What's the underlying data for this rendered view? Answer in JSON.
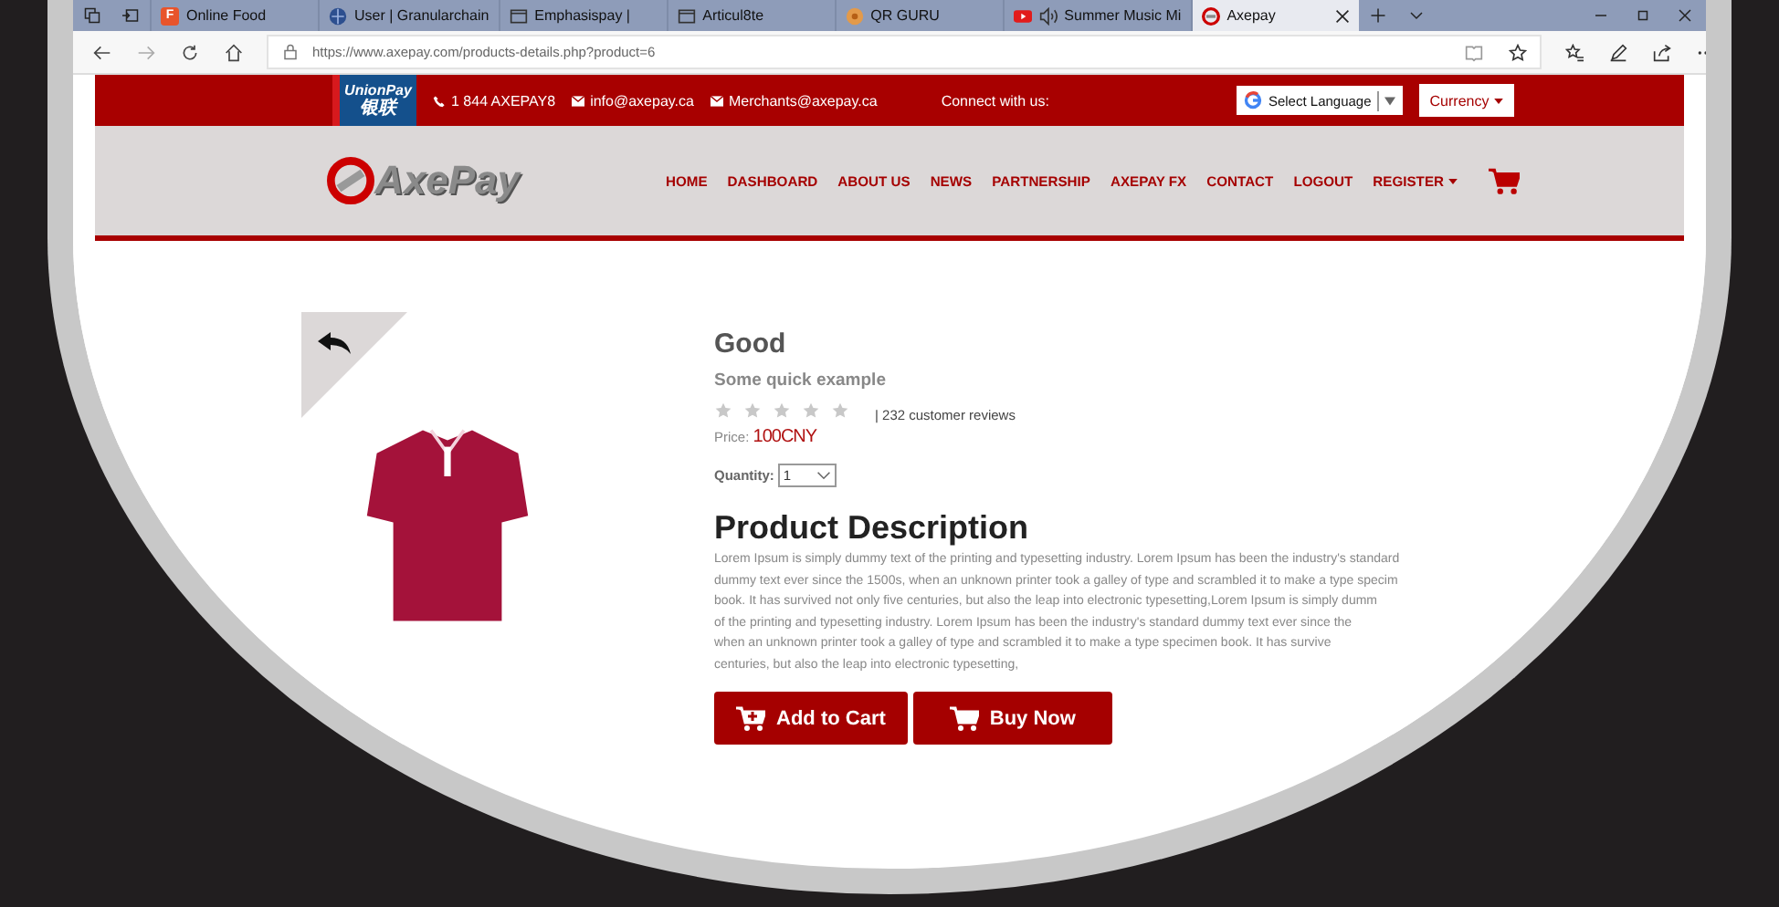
{
  "browser": {
    "tabs": [
      {
        "label": "Online Food",
        "kind": "food",
        "badge": "F",
        "selected": false
      },
      {
        "label": "User | Granularchain",
        "kind": "user",
        "selected": false
      },
      {
        "label": "Emphasispay |",
        "kind": "page",
        "selected": false
      },
      {
        "label": "Articul8te",
        "kind": "page",
        "selected": false
      },
      {
        "label": "QR GURU",
        "kind": "qr",
        "selected": false
      },
      {
        "label": "Summer Music Mi",
        "kind": "video",
        "audio": true,
        "selected": false
      },
      {
        "label": "Axepay",
        "kind": "axepay",
        "selected": true
      }
    ],
    "address": "https://www.axepay.com/products-details.php?product=6"
  },
  "topbar": {
    "logo": {
      "line1": "UnionPay",
      "line2": "银联"
    },
    "phone": "1 844 AXEPAY8",
    "emails": [
      "info@axepay.ca",
      "Merchants@axepay.ca"
    ],
    "connect": "Connect with us:",
    "language": "Select Language",
    "currency": "Currency"
  },
  "header": {
    "logo": "AxePay",
    "nav": [
      {
        "label": "HOME",
        "kind": "link"
      },
      {
        "label": "DASHBOARD",
        "kind": "link"
      },
      {
        "label": "ABOUT US",
        "kind": "link"
      },
      {
        "label": "NEWS",
        "kind": "link"
      },
      {
        "label": "PARTNERSHIP",
        "kind": "link"
      },
      {
        "label": "AXEPAY FX",
        "kind": "link"
      },
      {
        "label": "CONTACT",
        "kind": "link"
      },
      {
        "label": "LOGOUT",
        "kind": "link"
      },
      {
        "label": "REGISTER",
        "kind": "dropdown"
      }
    ]
  },
  "product": {
    "name": "Good",
    "subtitle": "Some quick example",
    "stars": 0,
    "reviews": "| 232 customer reviews",
    "price_label": "Price:",
    "price": "100CNY",
    "quantity_label": "Quantity:",
    "quantity": "1",
    "description_title": "Product Description",
    "description_lines": [
      "Lorem Ipsum is simply dummy text of the printing and typesetting industry. Lorem Ipsum has been the industry's standard",
      "dummy text ever since the 1500s, when an unknown printer took a galley of type and scrambled it to make a type specim",
      "book. It has survived not only five centuries, but also the leap into electronic typesetting,Lorem Ipsum is simply dumm",
      "of the printing and typesetting industry. Lorem Ipsum has been the industry's standard dummy text ever since the",
      "when an unknown printer took a galley of type and scrambled it to make a type specimen book. It has survive",
      "centuries, but also the leap into electronic typesetting,"
    ],
    "buttons": [
      {
        "label": "Add to Cart",
        "kind": "add"
      },
      {
        "label": "Buy Now",
        "kind": "buy"
      }
    ]
  }
}
